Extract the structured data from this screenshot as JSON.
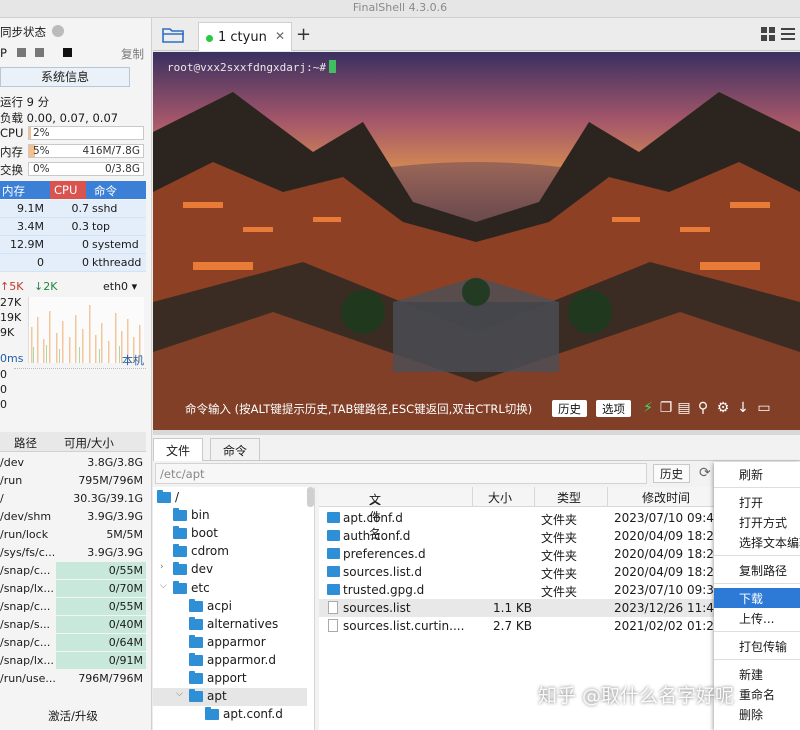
{
  "window": {
    "title": "FinalShell 4.3.0.6"
  },
  "left_panel": {
    "sync_status": "同步状态",
    "ip_label": "P",
    "copy_label": "复制",
    "sysinfo_button": "系统信息",
    "uptime": "运行 9 分",
    "load": "负载 0.00, 0.07, 0.07",
    "resources": [
      {
        "name": "CPU",
        "percent_text": "2%",
        "value": "",
        "fraction": 0.02
      },
      {
        "name": "内存",
        "percent_text": "5%",
        "value": "416M/7.8G",
        "fraction": 0.05
      },
      {
        "name": "交换",
        "percent_text": "0%",
        "value": "0/3.8G",
        "fraction": 0.0
      }
    ],
    "process_headers": {
      "mem": "内存",
      "cpu": "CPU",
      "cmd": "命令"
    },
    "processes": [
      {
        "mem": "9.1M",
        "cpu": "0.7",
        "cmd": "sshd"
      },
      {
        "mem": "3.4M",
        "cpu": "0.3",
        "cmd": "top"
      },
      {
        "mem": "12.9M",
        "cpu": "0",
        "cmd": "systemd"
      },
      {
        "mem": "0",
        "cpu": "0",
        "cmd": "kthreadd"
      }
    ],
    "network": {
      "up": "5K",
      "down": "2K",
      "interface": "eth0",
      "axis": [
        "27K",
        "19K",
        "9K"
      ],
      "up_color": "#c0392b",
      "down_color": "#1e8a3c"
    },
    "latency": {
      "unit": "0ms",
      "host": "本机",
      "values": [
        "0",
        "0",
        "0"
      ]
    },
    "disk_headers": {
      "path": "路径",
      "avail": "可用/大小"
    },
    "disks": [
      {
        "path": "/dev",
        "size": "3.8G/3.8G",
        "highlight": false
      },
      {
        "path": "/run",
        "size": "795M/796M",
        "highlight": false
      },
      {
        "path": "/",
        "size": "30.3G/39.1G",
        "highlight": false
      },
      {
        "path": "/dev/shm",
        "size": "3.9G/3.9G",
        "highlight": false
      },
      {
        "path": "/run/lock",
        "size": "5M/5M",
        "highlight": false
      },
      {
        "path": "/sys/fs/c...",
        "size": "3.9G/3.9G",
        "highlight": false
      },
      {
        "path": "/snap/c...",
        "size": "0/55M",
        "highlight": true
      },
      {
        "path": "/snap/lx...",
        "size": "0/70M",
        "highlight": true
      },
      {
        "path": "/snap/c...",
        "size": "0/55M",
        "highlight": true
      },
      {
        "path": "/snap/s...",
        "size": "0/40M",
        "highlight": true
      },
      {
        "path": "/snap/c...",
        "size": "0/64M",
        "highlight": true
      },
      {
        "path": "/snap/lx...",
        "size": "0/91M",
        "highlight": true
      },
      {
        "path": "/run/use...",
        "size": "796M/796M",
        "highlight": false
      }
    ],
    "upgrade": "激活/升级"
  },
  "tabbar": {
    "tab_label": "1 ctyun",
    "status_color": "#27c93f"
  },
  "terminal": {
    "prompt": "root@vxx2sxxfdngxdarj:~#",
    "command_hint": "命令输入 (按ALT键提示历史,TAB键路径,ESC键返回,双击CTRL切换)",
    "history_button": "历史",
    "options_button": "选项"
  },
  "file_panel": {
    "tabs": [
      "文件",
      "命令"
    ],
    "path": "/etc/apt",
    "history_button": "历史",
    "tree": [
      {
        "name": "/",
        "level": 0,
        "arrow": ""
      },
      {
        "name": "bin",
        "level": 1,
        "arrow": ""
      },
      {
        "name": "boot",
        "level": 1,
        "arrow": ""
      },
      {
        "name": "cdrom",
        "level": 1,
        "arrow": ""
      },
      {
        "name": "dev",
        "level": 1,
        "arrow": ">"
      },
      {
        "name": "etc",
        "level": 1,
        "arrow": "v"
      },
      {
        "name": "acpi",
        "level": 2,
        "arrow": ""
      },
      {
        "name": "alternatives",
        "level": 2,
        "arrow": ""
      },
      {
        "name": "apparmor",
        "level": 2,
        "arrow": ""
      },
      {
        "name": "apparmor.d",
        "level": 2,
        "arrow": ""
      },
      {
        "name": "apport",
        "level": 2,
        "arrow": ""
      },
      {
        "name": "apt",
        "level": 2,
        "arrow": "v"
      },
      {
        "name": "apt.conf.d",
        "level": 3,
        "arrow": ""
      }
    ],
    "columns": {
      "name": "文件名",
      "size": "大小",
      "type": "类型",
      "mtime": "修改时间"
    },
    "files": [
      {
        "name": "apt.conf.d",
        "size": "",
        "type": "文件夹",
        "mtime": "2023/07/10 09:4",
        "kind": "folder"
      },
      {
        "name": "auth.conf.d",
        "size": "",
        "type": "文件夹",
        "mtime": "2020/04/09 18:2",
        "kind": "folder"
      },
      {
        "name": "preferences.d",
        "size": "",
        "type": "文件夹",
        "mtime": "2020/04/09 18:2",
        "kind": "folder"
      },
      {
        "name": "sources.list.d",
        "size": "",
        "type": "文件夹",
        "mtime": "2020/04/09 18:2",
        "kind": "folder"
      },
      {
        "name": "trusted.gpg.d",
        "size": "",
        "type": "文件夹",
        "mtime": "2023/07/10 09:3",
        "kind": "folder"
      },
      {
        "name": "sources.list",
        "size": "1.1 KB",
        "type": "",
        "mtime": "2023/12/26 11:4",
        "kind": "file"
      },
      {
        "name": "sources.list.curtin....",
        "size": "2.7 KB",
        "type": "",
        "mtime": "2021/02/02 01:2",
        "kind": "file"
      }
    ]
  },
  "context_menu": {
    "items": [
      {
        "label": "刷新",
        "group": 0
      },
      {
        "label": "打开",
        "group": 1
      },
      {
        "label": "打开方式",
        "group": 1
      },
      {
        "label": "选择文本编辑",
        "group": 1
      },
      {
        "label": "复制路径",
        "group": 2
      },
      {
        "label": "下载",
        "group": 3
      },
      {
        "label": "上传...",
        "group": 3
      },
      {
        "label": "打包传输",
        "group": 4
      },
      {
        "label": "新建",
        "group": 5
      },
      {
        "label": "重命名",
        "group": 5
      },
      {
        "label": "删除",
        "group": 5
      }
    ],
    "active": "下载"
  },
  "watermark": "知乎 @取什么名字好呢"
}
